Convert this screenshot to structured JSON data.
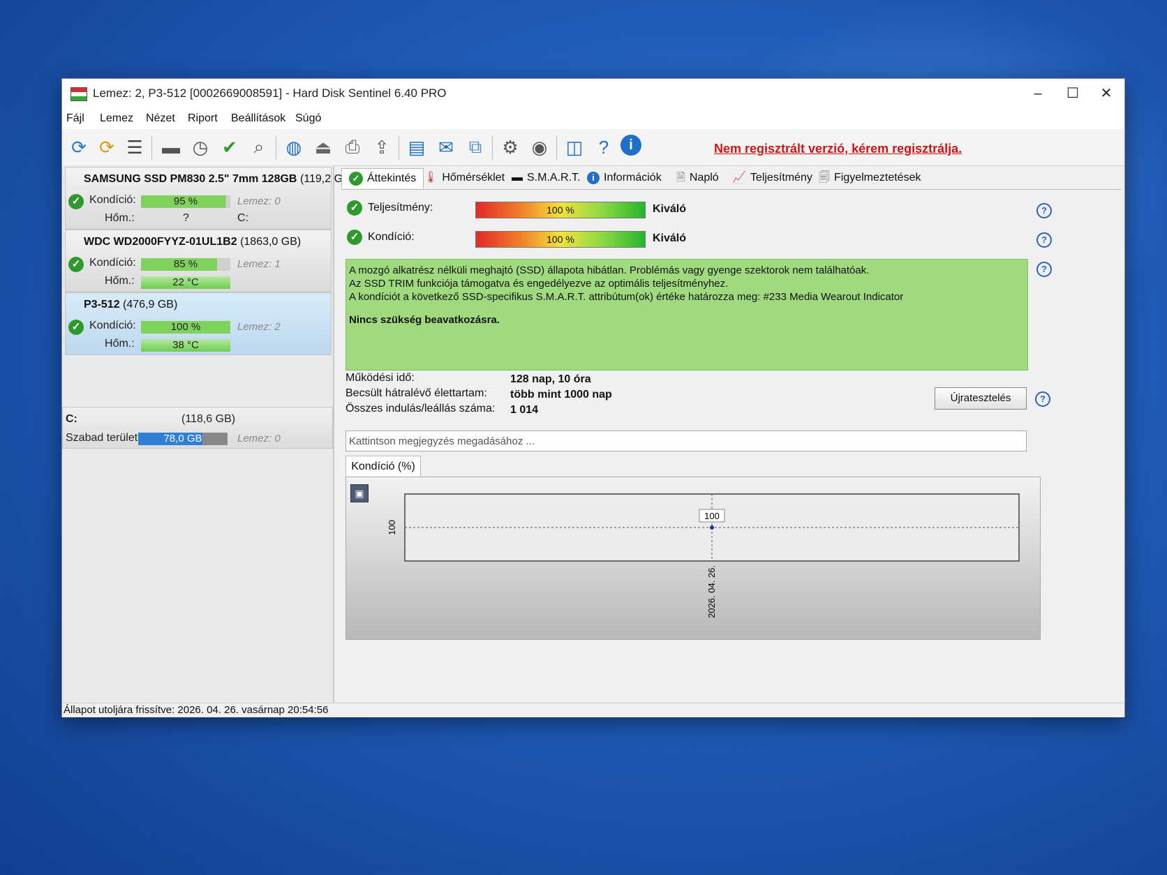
{
  "window": {
    "title": "Lemez: 2, P3-512 [0002669008591]  -  Hard Disk Sentinel 6.40 PRO",
    "min_glyph": "–",
    "max_glyph": "☐",
    "close_glyph": "✕"
  },
  "menu": [
    "Fájl",
    "Lemez",
    "Nézet",
    "Riport",
    "Beállítások",
    "Súgó"
  ],
  "toolbar": {
    "icons": [
      "refresh-icon",
      "refresh-warning-icon",
      "list-icon",
      "disk-icon",
      "disk-clock-icon",
      "disk-check-icon",
      "disk-search-icon",
      "globe-icon",
      "upload-icon",
      "print-icon",
      "export-icon",
      "report-icon",
      "mail-icon",
      "network-icon",
      "settings-icon",
      "sound-icon",
      "screenshot-icon",
      "help-icon",
      "info-icon"
    ],
    "register_link": "Nem regisztrált verzió, kérem regisztrálja."
  },
  "disks": [
    {
      "name": "SAMSUNG SSD PM830 2.5\" 7mm 128GB",
      "size": "(119,2 G",
      "cond_label": "Kondíció:",
      "cond": "95 %",
      "cond_frac": 0.95,
      "disk": "Lemez: 0",
      "temp_label": "Hőm.:",
      "temp": "?",
      "drive": "C:"
    },
    {
      "name": "WDC WD2000FYYZ-01UL1B2",
      "size": "(1863,0 GB)",
      "cond_label": "Kondíció:",
      "cond": "85 %",
      "cond_frac": 0.85,
      "disk": "Lemez: 1",
      "temp_label": "Hőm.:",
      "temp": "22 °C"
    },
    {
      "name": "P3-512",
      "size": "(476,9 GB)",
      "cond_label": "Kondíció:",
      "cond": "100 %",
      "cond_frac": 1.0,
      "disk": "Lemez: 2",
      "temp_label": "Hőm.:",
      "temp": "38 °C"
    }
  ],
  "volume": {
    "drive": "C:",
    "size": "(118,6 GB)",
    "free_label": "Szabad terület",
    "free": "78,0 GB",
    "disk": "Lemez: 0"
  },
  "tabs": [
    "Áttekintés",
    "Hőmérséklet",
    "S.M.A.R.T.",
    "Információk",
    "Napló",
    "Teljesítmény",
    "Figyelmeztetések"
  ],
  "overview": {
    "performance_label": "Teljesítmény:",
    "performance": "100 %",
    "performance_rating": "Kiváló",
    "condition_label": "Kondíció:",
    "condition": "100 %",
    "condition_rating": "Kiváló",
    "message_lines": [
      "A mozgó alkatrész nélküli meghajtó (SSD) állapota hibátlan. Problémás vagy gyenge szektorok nem találhatóak.",
      "Az SSD TRIM funkciója támogatva és engedélyezve az optimális teljesítményhez.",
      "A kondíciót a következő SSD-specifikus S.M.A.R.T. attribútum(ok) értéke határozza meg:  #233 Media Wearout Indicator"
    ],
    "message_bold": "Nincs szükség beavatkozásra.",
    "uptime_label": "Működési idő:",
    "uptime": "128 nap, 10 óra",
    "lifetime_label": "Becsült hátralévő élettartam:",
    "lifetime": "több mint 1000 nap",
    "starts_label": "Összes indulás/leállás száma:",
    "starts": "1 014",
    "retest_button": "Újratesztelés",
    "note_placeholder": "Kattintson megjegyzés megadásához ...",
    "chart_tab": "Kondíció  (%)"
  },
  "chart_data": {
    "type": "line",
    "x": [
      "2026. 04. 26."
    ],
    "values": [
      100
    ],
    "ytick": "100",
    "point_label": "100"
  },
  "status": "Állapot utoljára frissítve: 2026. 04. 26. vasárnap 20:54:56"
}
